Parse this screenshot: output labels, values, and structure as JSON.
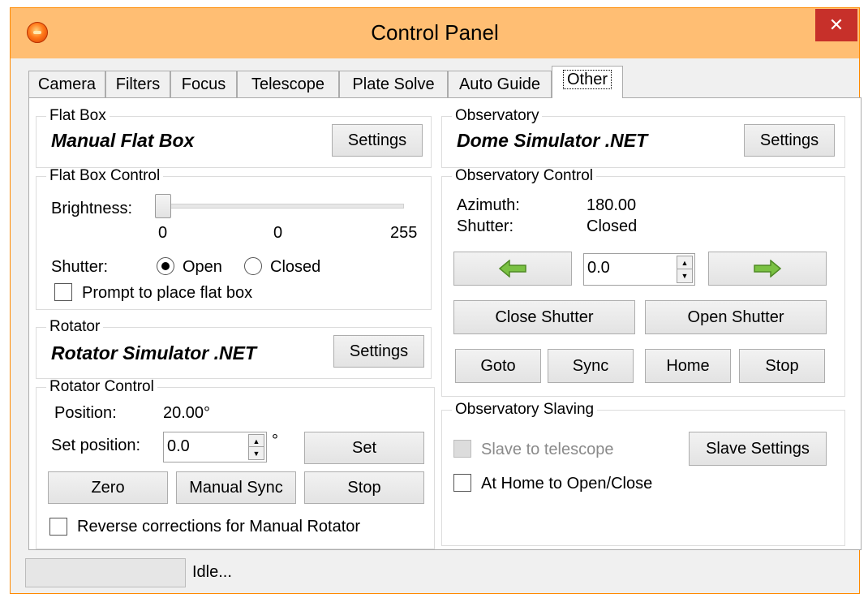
{
  "window": {
    "title": "Control Panel",
    "close_glyph": "✕"
  },
  "tabs": [
    "Camera",
    "Filters",
    "Focus",
    "Telescope",
    "Plate Solve",
    "Auto Guide",
    "Other"
  ],
  "active_tab": "Other",
  "flat_box": {
    "group_title": "Flat Box",
    "device_name": "Manual Flat Box",
    "settings_label": "Settings"
  },
  "flat_box_control": {
    "group_title": "Flat Box Control",
    "brightness_label": "Brightness:",
    "brightness_min": "0",
    "brightness_value": "0",
    "brightness_max": "255",
    "brightness_level": 0,
    "shutter_label": "Shutter:",
    "shutter_open_label": "Open",
    "shutter_closed_label": "Closed",
    "shutter_selected": "Open",
    "prompt_label": "Prompt to place flat box",
    "prompt_checked": false
  },
  "rotator": {
    "group_title": "Rotator",
    "device_name": "Rotator Simulator .NET",
    "settings_label": "Settings"
  },
  "rotator_control": {
    "group_title": "Rotator Control",
    "position_label": "Position:",
    "position_value": "20.00°",
    "set_position_label": "Set position:",
    "set_position_value": "0.0",
    "degree_symbol": "°",
    "set_label": "Set",
    "zero_label": "Zero",
    "manual_sync_label": "Manual Sync",
    "stop_label": "Stop",
    "reverse_label": "Reverse corrections for Manual Rotator",
    "reverse_checked": false
  },
  "observatory": {
    "group_title": "Observatory",
    "device_name": "Dome Simulator .NET",
    "settings_label": "Settings"
  },
  "observatory_control": {
    "group_title": "Observatory Control",
    "azimuth_label": "Azimuth:",
    "azimuth_value": "180.00",
    "shutter_label": "Shutter:",
    "shutter_value": "Closed",
    "step_value": "0.0",
    "close_shutter_label": "Close Shutter",
    "open_shutter_label": "Open Shutter",
    "goto_label": "Goto",
    "sync_label": "Sync",
    "home_label": "Home",
    "stop_label": "Stop",
    "arrow_color": "#7ac143"
  },
  "observatory_slaving": {
    "group_title": "Observatory Slaving",
    "slave_label": "Slave to telescope",
    "slave_enabled": false,
    "slave_settings_label": "Slave Settings",
    "home_open_close_label": "At Home to Open/Close",
    "home_open_close_checked": false
  },
  "status": {
    "text": "Idle..."
  }
}
